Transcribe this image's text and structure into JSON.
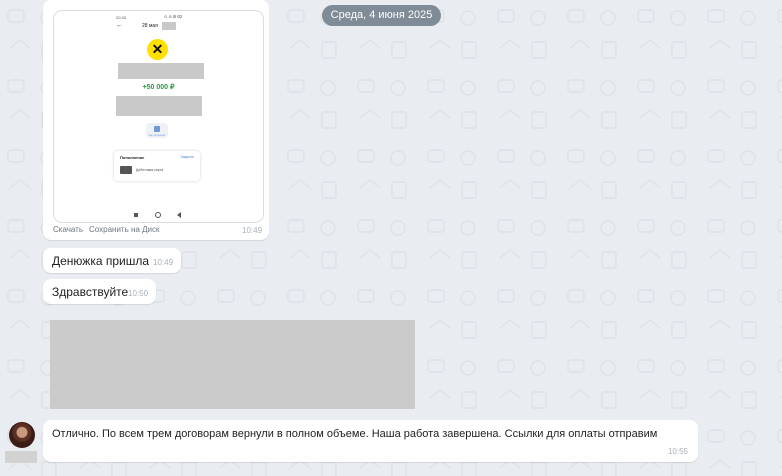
{
  "date_separator": "Среда, 4 июня 2025",
  "screenshot_message": {
    "phone": {
      "status_time": "20:33",
      "status_icons": "⊙ ⊘ ⊞ 🖾",
      "date_label": "28 мая",
      "amount": "+50 000 ₽",
      "action_label": "Не успешно",
      "card_title": "Пополнение",
      "card_link": "Закрыть",
      "card_sub": "Дебетовая карта"
    },
    "actions": {
      "download": "Скачать",
      "save_to_disk": "Сохранить на Диск"
    },
    "time": "10:49"
  },
  "messages": [
    {
      "text": "Денюжка пришла",
      "time": "10:49"
    },
    {
      "text": "Здравствуйте",
      "time": "10:50"
    }
  ],
  "reply": {
    "text": "Отлично. По всем трем договорам вернули в полном объеме. Наша работа завершена. Ссылки для оплаты отправим",
    "time": "10:55"
  },
  "colors": {
    "background": "#e9edf1",
    "date_pill": "#7f8b96",
    "amount_green": "#2a9d3a",
    "logo_yellow": "#ffe000"
  }
}
